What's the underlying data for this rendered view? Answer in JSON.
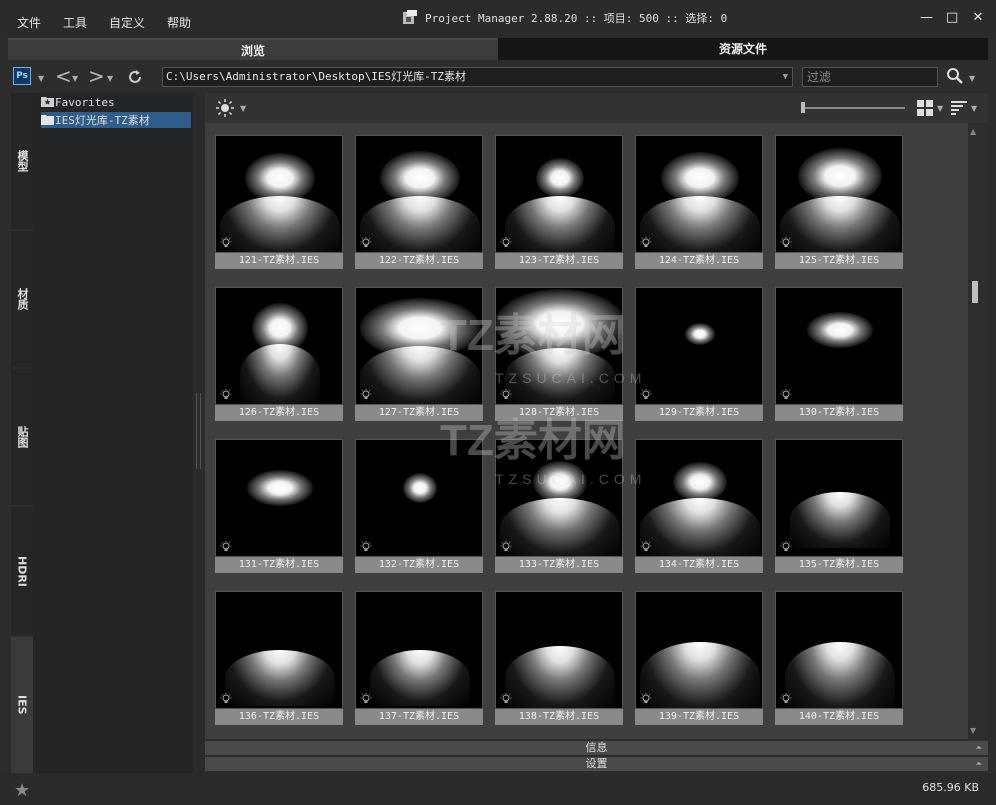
{
  "menu": {
    "items": [
      "文件",
      "工具",
      "自定义",
      "帮助"
    ]
  },
  "app": {
    "title": "Project Manager 2.88.20  :: 项目: 500  :: 选择: 0"
  },
  "window_controls": {
    "minimize": "—",
    "maximize": "□",
    "close": "✕"
  },
  "tabs": [
    {
      "label": "浏览",
      "active": true
    },
    {
      "label": "资源文件",
      "active": false
    }
  ],
  "toolbar": {
    "ps_label": "Ps",
    "path": "C:\\Users\\Administrator\\Desktop\\IES灯光库-TZ素材",
    "filter_placeholder": "过滤"
  },
  "side_tabs": [
    {
      "label": "模型",
      "active": false
    },
    {
      "label": "材质",
      "active": false
    },
    {
      "label": "贴图",
      "active": false
    },
    {
      "label": "HDRI",
      "active": false
    },
    {
      "label": "IES",
      "active": true
    }
  ],
  "tree": {
    "items": [
      {
        "label": "Favorites",
        "icon": "star-folder-icon",
        "selected": false
      },
      {
        "label": "IES灯光库-TZ素材",
        "icon": "folder-icon",
        "selected": true
      }
    ]
  },
  "thumbnails": [
    {
      "label": "121-TZ素材.IES"
    },
    {
      "label": "122-TZ素材.IES"
    },
    {
      "label": "123-TZ素材.IES"
    },
    {
      "label": "124-TZ素材.IES"
    },
    {
      "label": "125-TZ素材.IES"
    },
    {
      "label": "126-TZ素材.IES"
    },
    {
      "label": "127-TZ素材.IES"
    },
    {
      "label": "128-TZ素材.IES"
    },
    {
      "label": "129-TZ素材.IES"
    },
    {
      "label": "130-TZ素材.IES"
    },
    {
      "label": "131-TZ素材.IES"
    },
    {
      "label": "132-TZ素材.IES"
    },
    {
      "label": "133-TZ素材.IES"
    },
    {
      "label": "134-TZ素材.IES"
    },
    {
      "label": "135-TZ素材.IES"
    },
    {
      "label": "136-TZ素材.IES"
    },
    {
      "label": "137-TZ素材.IES"
    },
    {
      "label": "138-TZ素材.IES"
    },
    {
      "label": "139-TZ素材.IES"
    },
    {
      "label": "140-TZ素材.IES"
    }
  ],
  "panels": {
    "info": "信息",
    "settings": "设置"
  },
  "status": {
    "size": "685.96 KB"
  },
  "watermark": {
    "brand": "TZ素材网",
    "site": "TZSUCAI.COM"
  }
}
